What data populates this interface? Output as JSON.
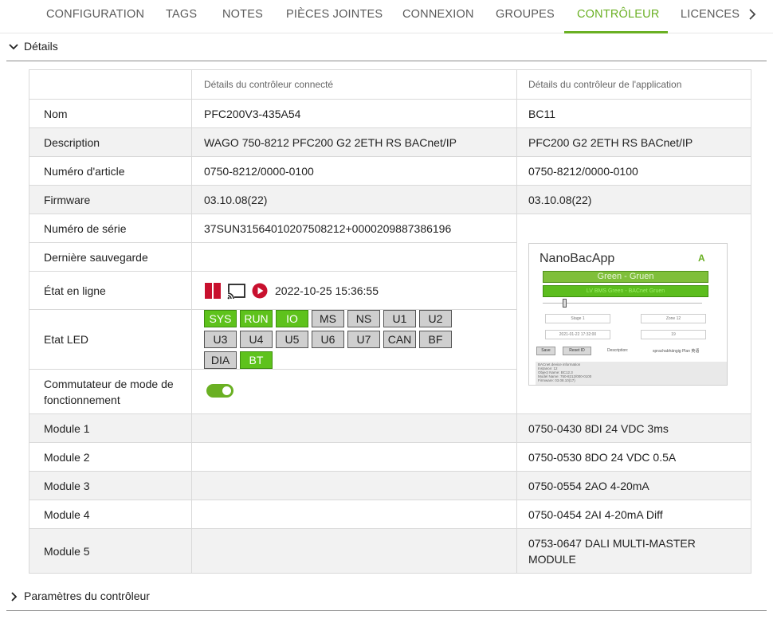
{
  "tabs": [
    {
      "label": "CONFIGURATION"
    },
    {
      "label": "TAGS"
    },
    {
      "label": "NOTES"
    },
    {
      "label": "PIÈCES JOINTES"
    },
    {
      "label": "CONNEXION"
    },
    {
      "label": "GROUPES"
    },
    {
      "label": "CONTRÔLEUR",
      "active": true
    },
    {
      "label": "LICENCES"
    }
  ],
  "details_section": {
    "title": "Détails"
  },
  "params_section": {
    "title": "Paramètres du contrôleur"
  },
  "table": {
    "col_connected": "Détails du contrôleur connecté",
    "col_application": "Détails du contrôleur de l'application",
    "rows": {
      "name": {
        "label": "Nom",
        "connected": "PFC200V3-435A54",
        "application": "BC11"
      },
      "description": {
        "label": "Description",
        "connected": "WAGO 750-8212 PFC200 G2 2ETH RS BACnet/IP",
        "application": "PFC200 G2 2ETH RS BACnet/IP"
      },
      "article": {
        "label": "Numéro d'article",
        "connected": "0750-8212/0000-0100",
        "application": "0750-8212/0000-0100"
      },
      "firmware": {
        "label": "Firmware",
        "connected": "03.10.08(22)",
        "application": "03.10.08(22)"
      },
      "serial": {
        "label": "Numéro de série",
        "connected": "37SUN31564010207508212+0000209887386196"
      },
      "backup": {
        "label": "Dernière sauvegarde",
        "connected": ""
      },
      "online": {
        "label": "État en ligne",
        "timestamp": "2022-10-25 15:36:55"
      },
      "led": {
        "label": "Etat LED"
      },
      "mode_switch": {
        "label": "Commutateur de mode de fonctionnement",
        "enabled": true
      },
      "module1": {
        "label": "Module 1",
        "application": "0750-0430 8DI 24 VDC 3ms"
      },
      "module2": {
        "label": "Module 2",
        "application": "0750-0530 8DO 24 VDC 0.5A"
      },
      "module3": {
        "label": "Module 3",
        "application": "0750-0554 2AO 4-20mA"
      },
      "module4": {
        "label": "Module 4",
        "application": "0750-0454 2AI 4-20mA Diff"
      },
      "module5": {
        "label": "Module 5",
        "application": "0753-0647 DALI MULTI-MASTER MODULE"
      }
    }
  },
  "leds": [
    {
      "label": "SYS",
      "on": true
    },
    {
      "label": "RUN",
      "on": true
    },
    {
      "label": "IO",
      "on": true
    },
    {
      "label": "MS",
      "on": false
    },
    {
      "label": "NS",
      "on": false
    },
    {
      "label": "U1",
      "on": false
    },
    {
      "label": "U2",
      "on": false
    },
    {
      "label": "U3",
      "on": false
    },
    {
      "label": "U4",
      "on": false
    },
    {
      "label": "U5",
      "on": false
    },
    {
      "label": "U6",
      "on": false
    },
    {
      "label": "U7",
      "on": false
    },
    {
      "label": "CAN",
      "on": false
    },
    {
      "label": "BF",
      "on": false
    },
    {
      "label": "DIA",
      "on": false
    },
    {
      "label": "BT",
      "on": true
    }
  ],
  "preview": {
    "title": "NanoBacApp",
    "badge": "A",
    "bar1": "Green - Gruen",
    "bar2": "LV BMS Green - BACnet Gruen",
    "in1": "Stage 1",
    "in2": "Zone 12",
    "in3": "2021-01-22 17:32:00",
    "in4": "19",
    "btn_save": "Save",
    "btn_reset": "Reset ID",
    "desc_label": "Description:",
    "desc_value": "sprachabhängig Plan 英语",
    "footer": [
      "BACnet device information",
      "Instance: 12",
      "Object Name: BC12.3",
      "Model Name: 750-8212/000-0100",
      "Firmware: 03.08.10(17)"
    ]
  },
  "colors": {
    "accent": "#6ab023",
    "led_on": "#5ec21c",
    "led_off": "#cfcfcf",
    "state_red": "#c8102e"
  }
}
